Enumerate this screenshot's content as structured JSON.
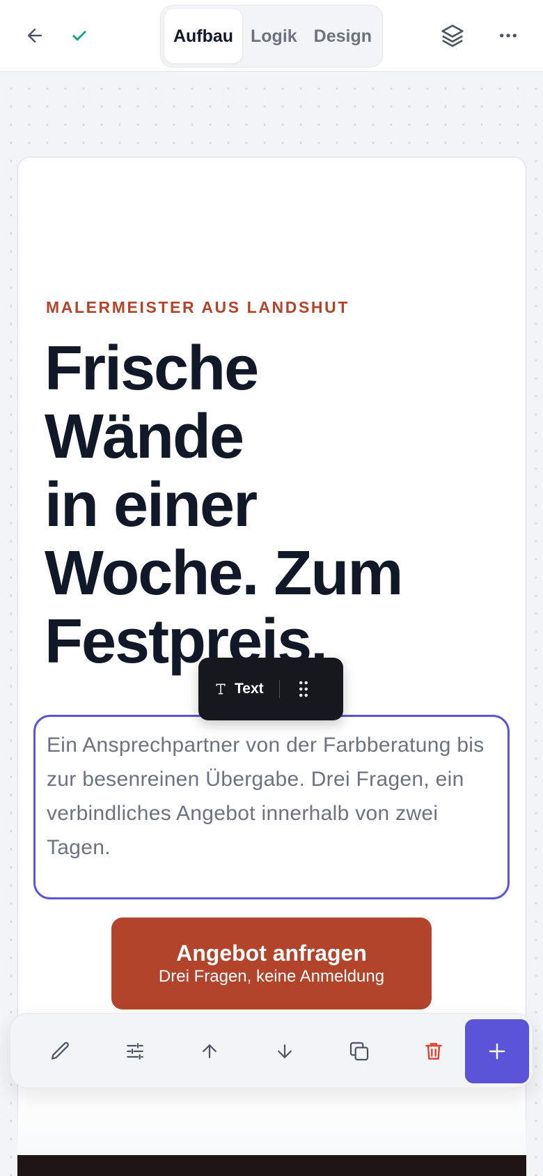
{
  "toolbar": {
    "back_icon": "arrow-left-icon",
    "saved_icon": "check-icon",
    "tabs": [
      {
        "label": "Aufbau",
        "active": true
      },
      {
        "label": "Logik",
        "active": false
      },
      {
        "label": "Design",
        "active": false
      }
    ],
    "layers_icon": "layers-icon",
    "more_icon": "more-horizontal-icon"
  },
  "hero": {
    "eyebrow": "MALERMEISTER AUS LANDSHUT",
    "headline_lines": [
      "Frische",
      "Wände",
      "in einer",
      "Woche. Zum",
      "Festpreis."
    ],
    "body": "Ein Ansprechpartner von der Farbberatung bis zur besenreinen Übergabe. Drei Fragen, ein verbindliches Angebot innerhalb von zwei Tagen.",
    "cta_title": "Angebot anfragen",
    "cta_subtitle": "Drei Fragen, keine Anmeldung"
  },
  "element_toolbar": {
    "type_icon": "text-type-icon",
    "label": "Text",
    "drag_icon": "drag-handle-icon"
  },
  "bottom_actions": {
    "items": [
      "edit",
      "settings",
      "move-up",
      "move-down",
      "duplicate",
      "delete",
      "add"
    ]
  },
  "colors": {
    "accent": "#5b54d6",
    "brand": "#b3442c",
    "saved": "#10a37f",
    "delete": "#e0412f",
    "headline": "#111827"
  }
}
